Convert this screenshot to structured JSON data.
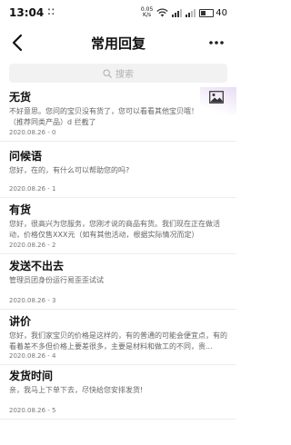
{
  "status_bar": {
    "time": "13:04",
    "notif_dots": "⁚⁚",
    "net_speed_value": "0.05",
    "net_speed_unit": "K/s",
    "battery": "40"
  },
  "header": {
    "title": "常用回复"
  },
  "search": {
    "placeholder": "搜索"
  },
  "replies": [
    {
      "title": "无货",
      "content": "不好意思。您问的宝贝没有货了，您可以看看其他宝贝哦！（推荐同类产品）d 拦截了",
      "date": "2020.08.26 - 0"
    },
    {
      "title": "问候语",
      "content": "您好，在的，有什么可以帮助您的吗?",
      "date": "2020.08.26 - 1"
    },
    {
      "title": "有货",
      "content": "您好，很高兴为您服务，您刚才说的商品有货。我们现在正在做活动，价格仅售XXX元（如有其他活动，根据实际情况而定）",
      "date": "2020.08.26 - 2"
    },
    {
      "title": "发送不出去",
      "content": "管理员团身份运行易歪歪试试",
      "date": "2020.08.26 - 3"
    },
    {
      "title": "讲价",
      "content": "您好，我们家宝贝的价格是这样的，有的普通的可能会便宜点，有的看着差不多但价格上要差很多，主要是材料和做工的不同，贵...",
      "date": "2020.08.26 - 4"
    },
    {
      "title": "发货时间",
      "content": "亲，我马上下单下去，尽快给您安排发货!",
      "date": "2020.08.26 - 5"
    }
  ]
}
